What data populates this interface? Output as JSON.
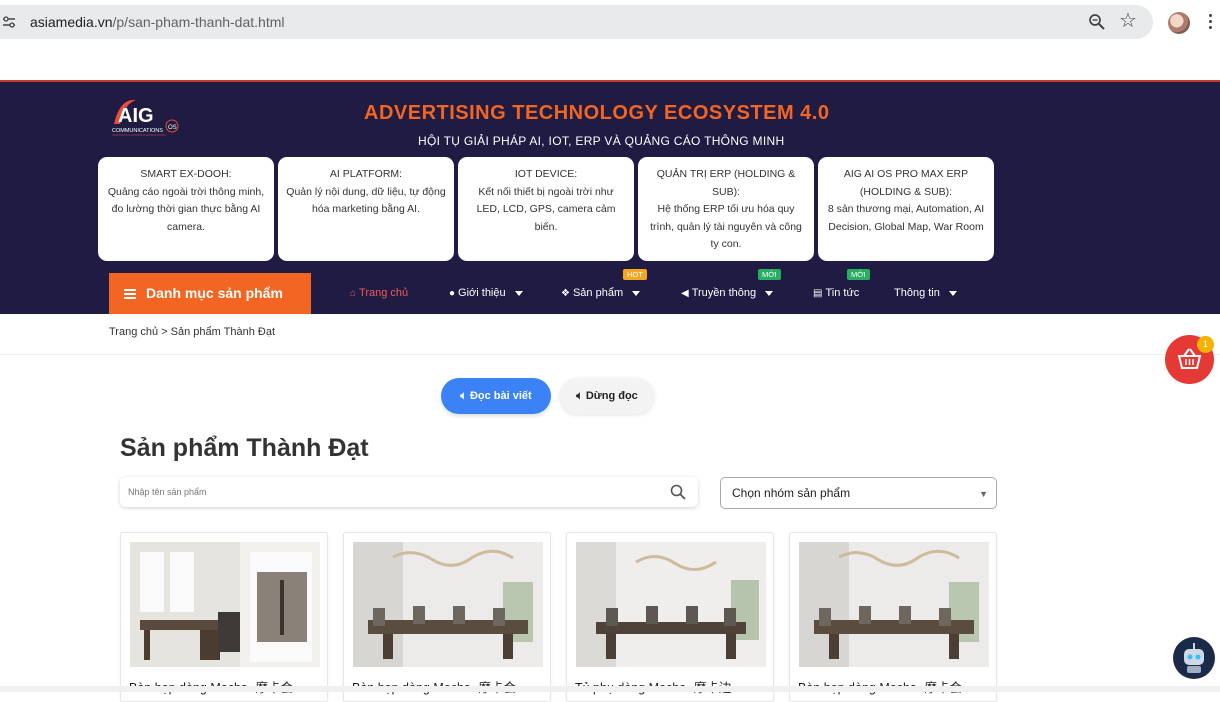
{
  "browser": {
    "url_host": "asiamedia.vn",
    "url_path": "/p/san-pham-thanh-dat.html"
  },
  "hero": {
    "title": "ADVERTISING TECHNOLOGY ECOSYSTEM 4.0",
    "subtitle": "HỘI TỤ GIẢI PHÁP AI, IOT, ERP VÀ QUẢNG CÁO THÔNG MINH",
    "logo_text": "AIG",
    "logo_caption": "COMMUNICATIONS"
  },
  "features": [
    {
      "title": "SMART EX-DOOH:",
      "desc": "Quảng cáo ngoài trời thông minh, đo lường thời gian thực bằng AI camera."
    },
    {
      "title": "AI PLATFORM:",
      "desc": "Quản lý nội dung, dữ liệu, tự động hóa marketing bằng AI."
    },
    {
      "title": "IOT DEVICE:",
      "desc": "Kết nối thiết bị ngoài trời như LED, LCD, GPS, camera cảm biến."
    },
    {
      "title": "QUẢN TRỊ ERP (HOLDING & SUB):",
      "desc": "Hệ thống ERP tối ưu hóa quy trình, quản lý tài nguyên và công ty con."
    },
    {
      "title": "AIG AI OS PRO MAX ERP (HOLDING & SUB):",
      "desc": "8 sản thương mại, Automation, AI Decision, Global Map, War Room"
    }
  ],
  "nav": {
    "category_button": "Danh mục sản phẩm",
    "items": [
      {
        "label": "Trang chủ"
      },
      {
        "label": "Giới thiệu"
      },
      {
        "label": "Sản phẩm",
        "badge": "HOT"
      },
      {
        "label": "Truyền thông",
        "badge": "MỚI"
      },
      {
        "label": "Tin tức",
        "badge": "MỚI"
      },
      {
        "label": "Thông tin"
      }
    ]
  },
  "breadcrumb": "Trang chủ > Sản phẩm Thành Đạt",
  "cart_count": "1",
  "reader": {
    "read_label": "Đọc bài viết",
    "stop_label": "Dừng đọc"
  },
  "page_title": "Sản phẩm Thành Đạt",
  "search": {
    "placeholder": "Nhập tên sản phẩm"
  },
  "group_select": {
    "value": "Chọn nhóm sản phẩm"
  },
  "products": [
    {
      "name": "Bàn họp dòng Mocha -摩卡会"
    },
    {
      "name": "Bàn họp dòng Mocha -摩卡会"
    },
    {
      "name": "Tủ phụ dòng Mocha -摩卡边"
    },
    {
      "name": "Bàn họp dòng Mocha -摩卡会"
    }
  ]
}
